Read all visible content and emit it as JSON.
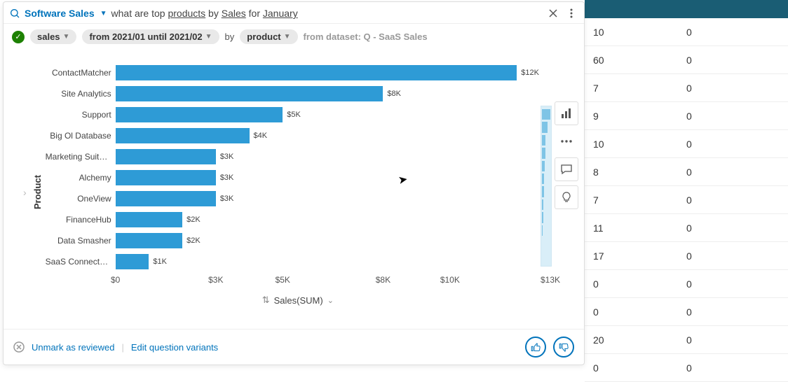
{
  "header": {
    "topic": "Software Sales",
    "query_prefix": "what are top ",
    "query_u1": "products",
    "query_mid": " by ",
    "query_u2": "Sales",
    "query_for": " for ",
    "query_u3": "January"
  },
  "chips": {
    "measure": "sales",
    "daterange": "from 2021/01 until 2021/02",
    "by": "by",
    "dimension": "product",
    "dataset": "from dataset: Q - SaaS Sales"
  },
  "chart_data": {
    "type": "bar",
    "ylabel": "Product",
    "xlabel": "Sales(SUM)",
    "categories": [
      "ContactMatcher",
      "Site Analytics",
      "Support",
      "Big Ol Database",
      "Marketing Suite ...",
      "Alchemy",
      "OneView",
      "FinanceHub",
      "Data Smasher",
      "SaaS Connector..."
    ],
    "values": [
      12000,
      8000,
      5000,
      4000,
      3000,
      3000,
      3000,
      2000,
      2000,
      1000
    ],
    "value_labels": [
      "$12K",
      "$8K",
      "$5K",
      "$4K",
      "$3K",
      "$3K",
      "$3K",
      "$2K",
      "$2K",
      "$1K"
    ],
    "x_ticks": [
      "$0",
      "$3K",
      "$5K",
      "$8K",
      "$10K",
      "$13K"
    ],
    "x_tick_vals": [
      0,
      3000,
      5000,
      8000,
      10000,
      13000
    ],
    "xlim": [
      0,
      13000
    ]
  },
  "footer": {
    "unmark": "Unmark as reviewed",
    "edit": "Edit question variants"
  },
  "bg_table": {
    "rows": [
      {
        "c1": "10",
        "c2": "0"
      },
      {
        "c1": "60",
        "c2": "0"
      },
      {
        "c1": "7",
        "c2": "0"
      },
      {
        "c1": "9",
        "c2": "0"
      },
      {
        "c1": "10",
        "c2": "0"
      },
      {
        "c1": "8",
        "c2": "0"
      },
      {
        "c1": "7",
        "c2": "0"
      },
      {
        "c1": "11",
        "c2": "0"
      },
      {
        "c1": "17",
        "c2": "0"
      },
      {
        "c1": "0",
        "c2": "0"
      },
      {
        "c1": "0",
        "c2": "0"
      },
      {
        "c1": "20",
        "c2": "0"
      },
      {
        "c1": "0",
        "c2": "0"
      }
    ]
  }
}
